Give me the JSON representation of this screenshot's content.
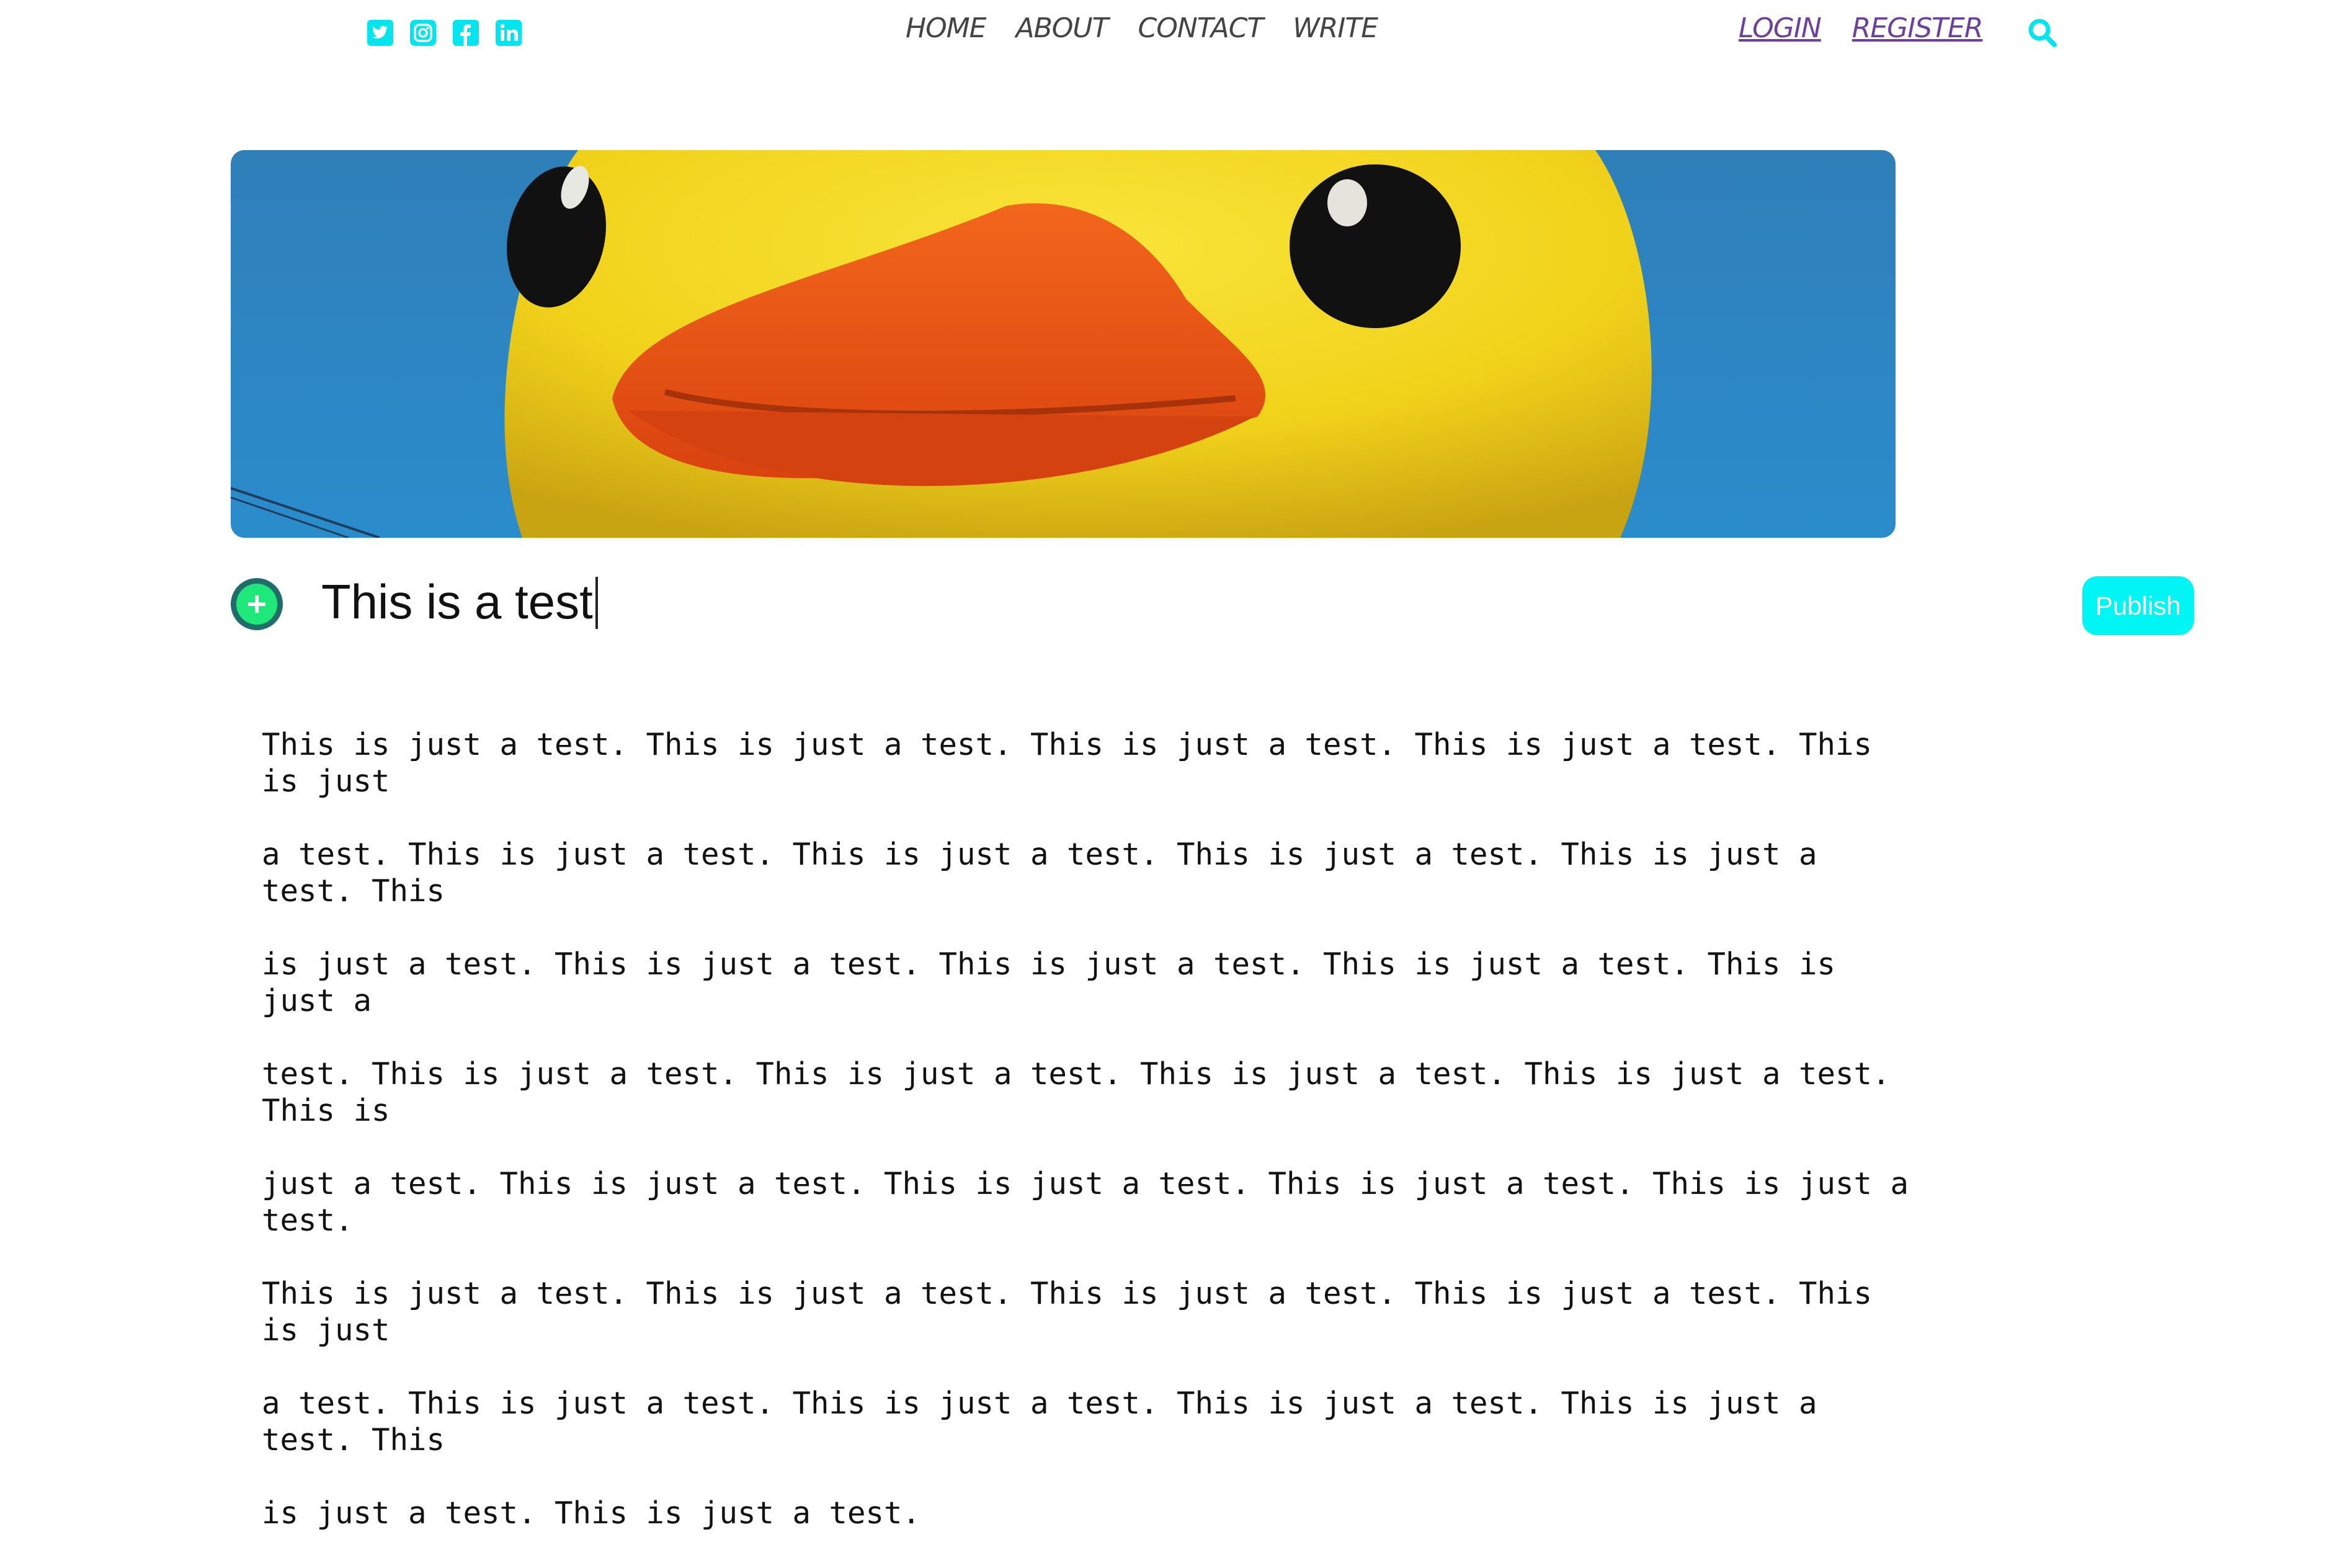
{
  "social": [
    {
      "name": "twitter-icon"
    },
    {
      "name": "instagram-icon"
    },
    {
      "name": "facebook-icon"
    },
    {
      "name": "linkedin-icon"
    }
  ],
  "nav": {
    "home": "HOME",
    "about": "ABOUT",
    "contact": "CONTACT",
    "write": "WRITE"
  },
  "auth": {
    "login": "LOGIN",
    "register": "REGISTER"
  },
  "colors": {
    "accent": "#00f5f5",
    "link": "#6c3fa0",
    "add_button": "#1ee87a"
  },
  "post": {
    "title": "This is a test",
    "publish_label": "Publish",
    "body_lines": [
      "This is just a test. This is just a test. This is just a test. This is just a test. This is just",
      "a test. This is just a test. This is just a test. This is just a test. This is just a test. This",
      "is just a test. This is just a test. This is just a test. This is just a test. This is just a",
      "test. This is just a test. This is just a test. This is just a test. This is just a test. This is",
      "just a test. This is just a test. This is just a test. This is just a test. This is just a test.",
      "This is just a test. This is just a test. This is just a test. This is just a test. This is just",
      "a test. This is just a test. This is just a test. This is just a test. This is just a test. This",
      "is just a test. This is just a test."
    ]
  }
}
